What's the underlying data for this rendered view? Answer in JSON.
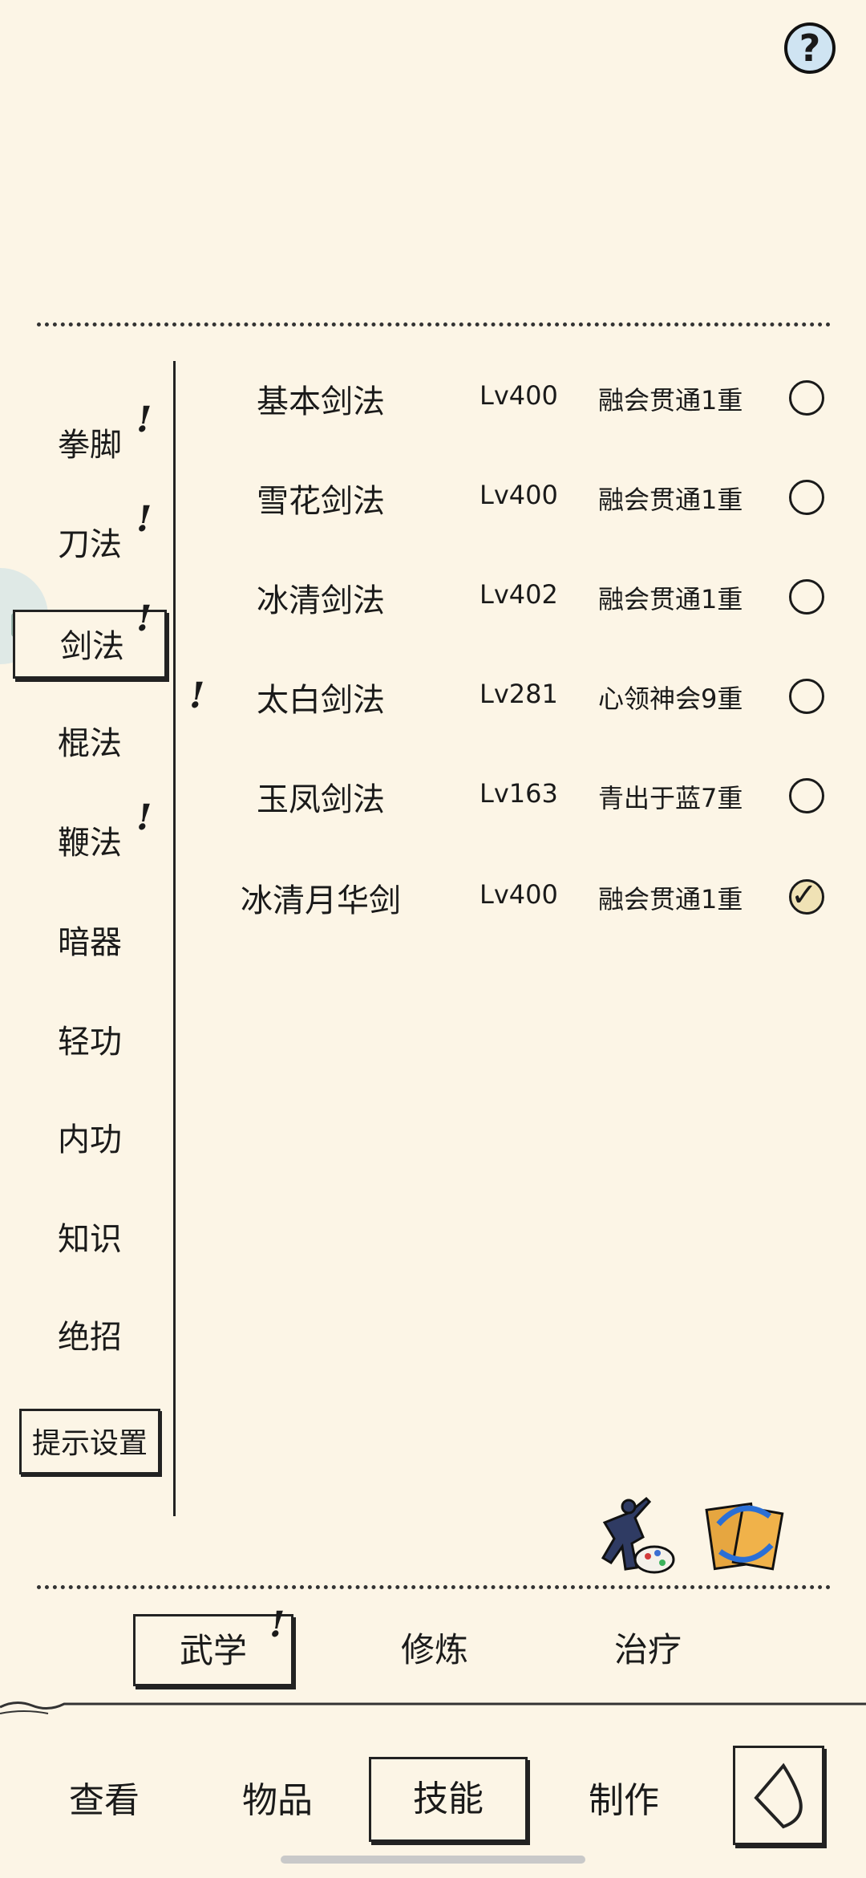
{
  "help_label": "?",
  "categories": [
    {
      "label": "拳脚",
      "alert": "!"
    },
    {
      "label": "刀法",
      "alert": "!"
    },
    {
      "label": "剑法",
      "alert": "!"
    },
    {
      "label": "棍法",
      "alert": ""
    },
    {
      "label": "鞭法",
      "alert": "!"
    },
    {
      "label": "暗器",
      "alert": ""
    },
    {
      "label": "轻功",
      "alert": ""
    },
    {
      "label": "内功",
      "alert": ""
    },
    {
      "label": "知识",
      "alert": ""
    },
    {
      "label": "绝招",
      "alert": ""
    }
  ],
  "selected_category": "剑法",
  "hint_settings_label": "提示设置",
  "skills": [
    {
      "name": "基本剑法",
      "level": "Lv400",
      "realm": "融会贯通1重",
      "checked": false,
      "alert": ""
    },
    {
      "name": "雪花剑法",
      "level": "Lv400",
      "realm": "融会贯通1重",
      "checked": false,
      "alert": ""
    },
    {
      "name": "冰清剑法",
      "level": "Lv402",
      "realm": "融会贯通1重",
      "checked": false,
      "alert": ""
    },
    {
      "name": "太白剑法",
      "level": "Lv281",
      "realm": "心领神会9重",
      "checked": false,
      "alert": "!"
    },
    {
      "name": "玉凤剑法",
      "level": "Lv163",
      "realm": "青出于蓝7重",
      "checked": false,
      "alert": ""
    },
    {
      "name": "冰清月华剑",
      "level": "Lv400",
      "realm": "融会贯通1重",
      "checked": true,
      "alert": ""
    }
  ],
  "check_mark": "✓",
  "sub_tabs": [
    {
      "label": "武学",
      "alert": "!"
    },
    {
      "label": "修炼",
      "alert": ""
    },
    {
      "label": "治疗",
      "alert": ""
    }
  ],
  "nav": [
    {
      "label": "查看"
    },
    {
      "label": "物品"
    },
    {
      "label": "技能"
    },
    {
      "label": "制作"
    }
  ],
  "colors": {
    "background": "#fcf5e6",
    "ink": "#1a1a1a",
    "help_fill": "#cfe4f2"
  }
}
